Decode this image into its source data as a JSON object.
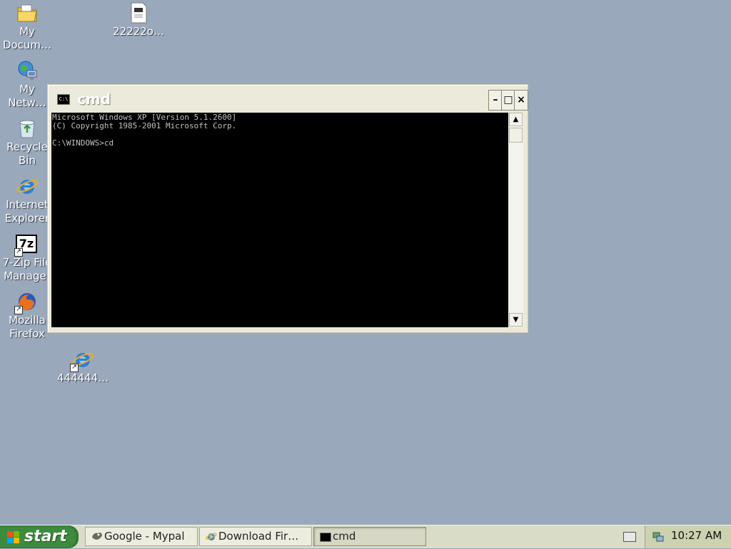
{
  "desktop": {
    "icons": [
      {
        "label": "My\nDocum…",
        "icon": "my-documents-folder-icon"
      },
      {
        "label": "My\nNetw…",
        "icon": "my-network-places-icon"
      },
      {
        "label": "Recycle\nBin",
        "icon": "recycle-bin-icon"
      },
      {
        "label": "Internet\nExplorer",
        "icon": "internet-explorer-icon"
      },
      {
        "label": "7-Zip File\nManager",
        "icon": "7zip-icon"
      },
      {
        "label": "Mozilla\nFirefox",
        "icon": "firefox-icon"
      },
      {
        "label": "22222o…",
        "icon": "document-file-icon"
      },
      {
        "label": "444444…",
        "icon": "internet-explorer-shortcut-icon"
      }
    ],
    "seven_zip_glyph": "7z",
    "shortcut_arrow": "↗"
  },
  "window": {
    "title": "cmd",
    "icon_text": "C:\\",
    "buttons": {
      "minimize": "–",
      "maximize": "□",
      "close": "×"
    },
    "console_text": "Microsoft Windows XP [Version 5.1.2600]\n(C) Copyright 1985-2001 Microsoft Corp.\n\nC:\\WINDOWS>cd",
    "scroll_up": "▲",
    "scroll_down": "▼"
  },
  "taskbar": {
    "start_label": "start",
    "tasks": [
      {
        "label": "Google - Mypal",
        "icon": "mypal-icon",
        "active": false
      },
      {
        "label": "Download Fir…",
        "icon": "internet-explorer-icon",
        "active": false
      },
      {
        "label": "cmd",
        "icon": "cmd-icon",
        "active": true
      }
    ],
    "clock": "10:27 AM"
  },
  "colors": {
    "desktop": "#9aa8bb",
    "console_bg": "#000000",
    "console_fg": "#c0c0c0",
    "start_green": "#3d8b3d",
    "taskbar": "#d9dcc6"
  }
}
